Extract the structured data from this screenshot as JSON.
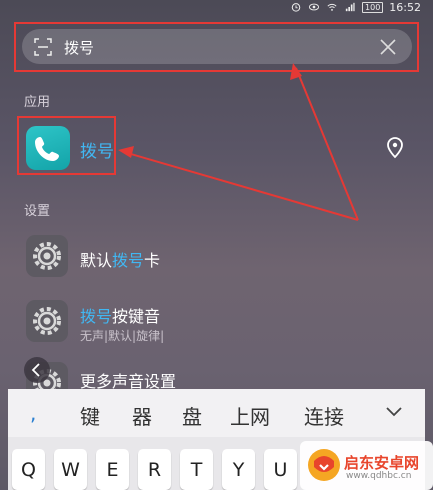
{
  "status_bar": {
    "time": "16:52",
    "battery": "100"
  },
  "search": {
    "query": "拨号"
  },
  "sections": {
    "apps": "应用",
    "settings": "设置"
  },
  "app_result": {
    "name": "拨号",
    "icon": "phone-icon"
  },
  "settings_results": [
    {
      "title_prefix": "默认",
      "title_highlight": "拨号",
      "title_suffix": "卡",
      "subtitle": ""
    },
    {
      "title_prefix": "",
      "title_highlight": "拨号",
      "title_suffix": "按键音",
      "subtitle": "无声|默认|旋律|"
    },
    {
      "title_prefix": "更多声音设置",
      "title_highlight": "",
      "title_suffix": "",
      "subtitle": ""
    }
  ],
  "keyboard": {
    "candidates": [
      ",",
      "键",
      "器",
      "盘",
      "上网",
      "连接"
    ],
    "keys": [
      "Q",
      "W",
      "E",
      "R",
      "T",
      "Y",
      "U"
    ]
  },
  "watermark": {
    "name": "启东安卓网",
    "url": "www.qdhbc.cn"
  },
  "colors": {
    "highlight": "#41b7f2",
    "annotation": "#e53935",
    "app_icon": "#1fb3b8"
  }
}
